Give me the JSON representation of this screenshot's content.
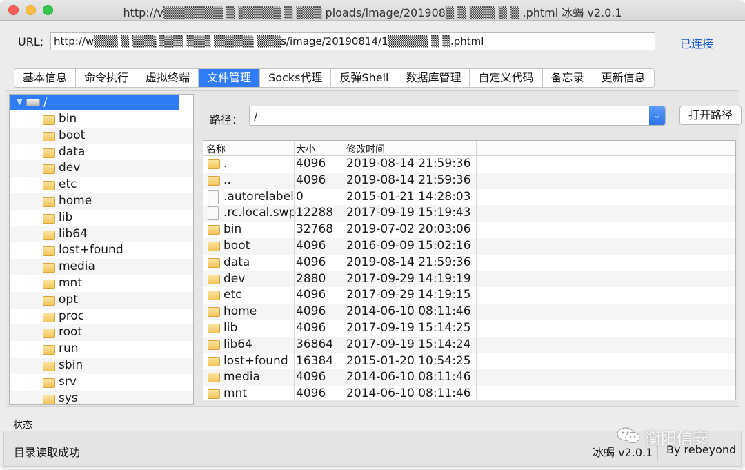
{
  "window": {
    "title": "http://v▒▒▒▒▒▒▒ ▒ ▒▒▒▒▒ ▒ ▒▒▒ ploads/image/201908▒ ▒ ▒▒▒ ▒ ▒ .phtml   冰蝎 v2.0.1"
  },
  "connection": {
    "url_label": "URL:",
    "url_value": "http://w▒▒▒ ▒ ▒▒▒ ▒▒▒ ▒▒▒ ▒▒▒▒▒ ▒▒▒s/image/20190814/1▒▒▒▒▒ ▒ ▒.phtml",
    "status": "已连接"
  },
  "tabs": [
    {
      "label": "基本信息",
      "active": false
    },
    {
      "label": "命令执行",
      "active": false
    },
    {
      "label": "虚拟终端",
      "active": false
    },
    {
      "label": "文件管理",
      "active": true
    },
    {
      "label": "Socks代理",
      "active": false
    },
    {
      "label": "反弹Shell",
      "active": false
    },
    {
      "label": "数据库管理",
      "active": false
    },
    {
      "label": "自定义代码",
      "active": false
    },
    {
      "label": "备忘录",
      "active": false
    },
    {
      "label": "更新信息",
      "active": false
    }
  ],
  "tree": {
    "root": "/",
    "items": [
      "bin",
      "boot",
      "data",
      "dev",
      "etc",
      "home",
      "lib",
      "lib64",
      "lost+found",
      "media",
      "mnt",
      "opt",
      "proc",
      "root",
      "run",
      "sbin",
      "srv",
      "sys"
    ]
  },
  "path": {
    "label": "路径：",
    "value": "/",
    "open_button": "打开路径"
  },
  "table": {
    "headers": {
      "name": "名称",
      "size": "大小",
      "modified": "修改时间"
    },
    "rows": [
      {
        "type": "folder",
        "name": ".",
        "size": "4096",
        "modified": "2019-08-14 21:59:36"
      },
      {
        "type": "folder",
        "name": "..",
        "size": "4096",
        "modified": "2019-08-14 21:59:36"
      },
      {
        "type": "file",
        "name": ".autorelabel",
        "size": "0",
        "modified": "2015-01-21 14:28:03"
      },
      {
        "type": "file",
        "name": ".rc.local.swp",
        "size": "12288",
        "modified": "2017-09-19 15:19:43"
      },
      {
        "type": "folder",
        "name": "bin",
        "size": "32768",
        "modified": "2019-07-02 20:03:06"
      },
      {
        "type": "folder",
        "name": "boot",
        "size": "4096",
        "modified": "2016-09-09 15:02:16"
      },
      {
        "type": "folder",
        "name": "data",
        "size": "4096",
        "modified": "2019-08-14 21:59:36"
      },
      {
        "type": "folder",
        "name": "dev",
        "size": "2880",
        "modified": "2017-09-29 14:19:19"
      },
      {
        "type": "folder",
        "name": "etc",
        "size": "4096",
        "modified": "2017-09-29 14:19:15"
      },
      {
        "type": "folder",
        "name": "home",
        "size": "4096",
        "modified": "2014-06-10 08:11:46"
      },
      {
        "type": "folder",
        "name": "lib",
        "size": "4096",
        "modified": "2017-09-19 15:14:25"
      },
      {
        "type": "folder",
        "name": "lib64",
        "size": "36864",
        "modified": "2017-09-19 15:14:24"
      },
      {
        "type": "folder",
        "name": "lost+found",
        "size": "16384",
        "modified": "2015-01-20 10:54:25"
      },
      {
        "type": "folder",
        "name": "media",
        "size": "4096",
        "modified": "2014-06-10 08:11:46"
      },
      {
        "type": "folder",
        "name": "mnt",
        "size": "4096",
        "modified": "2014-06-10 08:11:46"
      }
    ]
  },
  "status": {
    "section_label": "状态",
    "message": "目录读取成功",
    "version": "冰蝎 v2.0.1",
    "author": "By rebeyond",
    "watermark": "衡阳信安"
  },
  "colors": {
    "accent": "#2f7cf6",
    "link": "#1b5fd1",
    "folder": "#f2c65c"
  }
}
